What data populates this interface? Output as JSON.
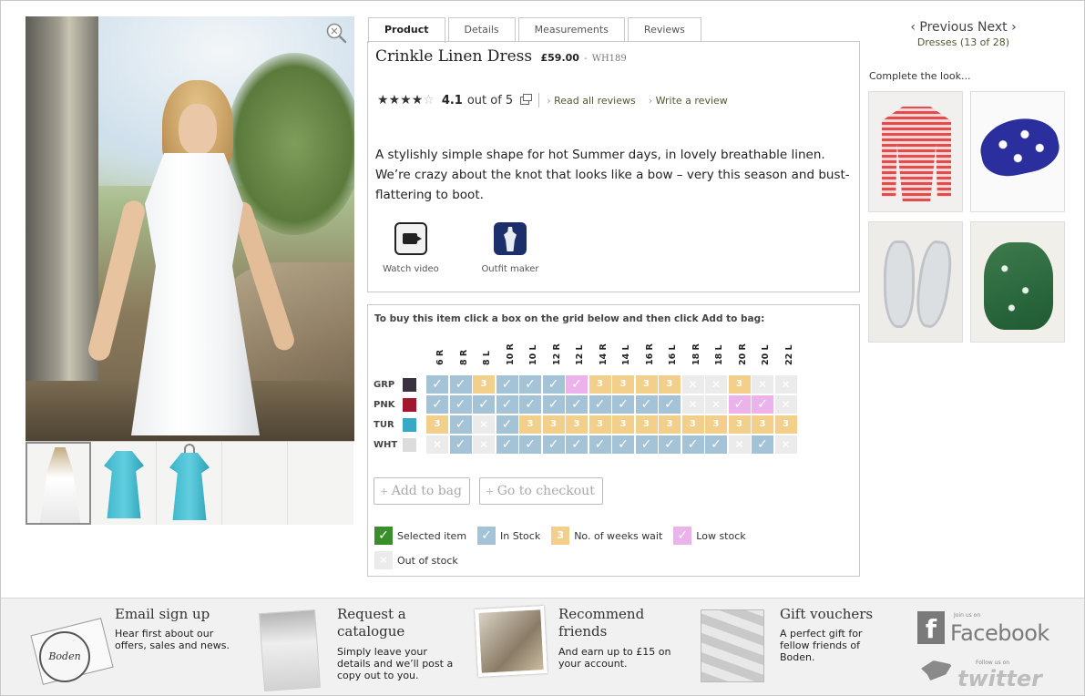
{
  "product": {
    "name": "Crinkle Linen Dress",
    "price": "£59.00",
    "code_sep": " - ",
    "code": "WH189",
    "rating": 4.1,
    "rating_text": "4.1",
    "rating_of": "out of 5",
    "read_reviews": "Read all reviews",
    "write_review": "Write a review",
    "description": "A stylishly simple shape for hot Summer days, in lovely breathable linen. We’re crazy about the knot that looks like a bow – very this season and bust-flattering to boot.",
    "watch_video": "Watch video",
    "outfit_maker": "Outfit maker"
  },
  "tabs": [
    {
      "label": "Product",
      "active": true
    },
    {
      "label": "Details",
      "active": false
    },
    {
      "label": "Measurements",
      "active": false
    },
    {
      "label": "Reviews",
      "active": false
    }
  ],
  "icons": {
    "zoom": "zoom-icon",
    "video": "video-camera-icon",
    "outfit": "outfit-icon",
    "popup": "popup-window-icon"
  },
  "grid": {
    "instruction": "To buy this item click a box on the grid below and then click Add to bag:",
    "sizes": [
      "6 R",
      "8 R",
      "8 L",
      "10 R",
      "10 L",
      "12 R",
      "12 L",
      "14 R",
      "14 L",
      "16 R",
      "16 L",
      "18 R",
      "18 L",
      "20 R",
      "20 L",
      "22 L"
    ],
    "rows": [
      {
        "code": "GRP",
        "color": "#3a3142",
        "cells": [
          "in",
          "in",
          "3",
          "in",
          "in",
          "in",
          "low",
          "3",
          "3",
          "3",
          "3",
          "out",
          "out",
          "3",
          "out",
          "out"
        ]
      },
      {
        "code": "PNK",
        "color": "#a3172e",
        "cells": [
          "in",
          "in",
          "in",
          "in",
          "in",
          "in",
          "in",
          "in",
          "in",
          "in",
          "in",
          "out",
          "out",
          "low",
          "low",
          "out"
        ]
      },
      {
        "code": "TUR",
        "color": "#37a9c4",
        "cells": [
          "3",
          "in",
          "out",
          "in",
          "3",
          "3",
          "3",
          "3",
          "3",
          "3",
          "3",
          "3",
          "3",
          "3",
          "3",
          "3"
        ]
      },
      {
        "code": "WHT",
        "color": "#dcdcdc",
        "cells": [
          "out",
          "in",
          "out",
          "in",
          "in",
          "in",
          "in",
          "in",
          "in",
          "in",
          "in",
          "in",
          "in",
          "out",
          "in",
          "out"
        ]
      }
    ],
    "wait_weeks": "3",
    "add_to_bag": "Add to bag",
    "checkout": "Go to checkout"
  },
  "legend": {
    "selected": "Selected item",
    "in_stock": "In Stock",
    "weeks": "No. of weeks wait",
    "weeks_value": "3",
    "low": "Low stock",
    "out": "Out of stock"
  },
  "nav": {
    "prev": "‹ Previous",
    "next": "Next ›",
    "crumb": "Dresses (13 of 28)"
  },
  "complete_look": {
    "heading": "Complete the look...",
    "items": [
      "cardigan",
      "polka-dot-hat",
      "silver-sandals",
      "green-scarf"
    ]
  },
  "footer": {
    "email_title": "Email sign up",
    "email_text": "Hear first about our offers, sales and news.",
    "email_stamp": "Boden",
    "catalogue_title": "Request a catalogue",
    "catalogue_text": "Simply leave your details and we’ll post a copy out to you.",
    "recommend_title": "Recommend friends",
    "recommend_text": "And earn up to £15 on your account.",
    "gift_title": "Gift vouchers",
    "gift_text": "A perfect gift for fellow friends of Boden.",
    "facebook_join": "Join us on",
    "facebook": "Facebook",
    "twitter_follow": "Follow us on",
    "twitter": "twitter"
  },
  "colors": {
    "in_stock": "#a5c3d6",
    "low_stock": "#ecb2ec",
    "wait": "#f3cf8c",
    "out_of_stock": "#ecebeb",
    "selected": "#3a8f2a"
  }
}
